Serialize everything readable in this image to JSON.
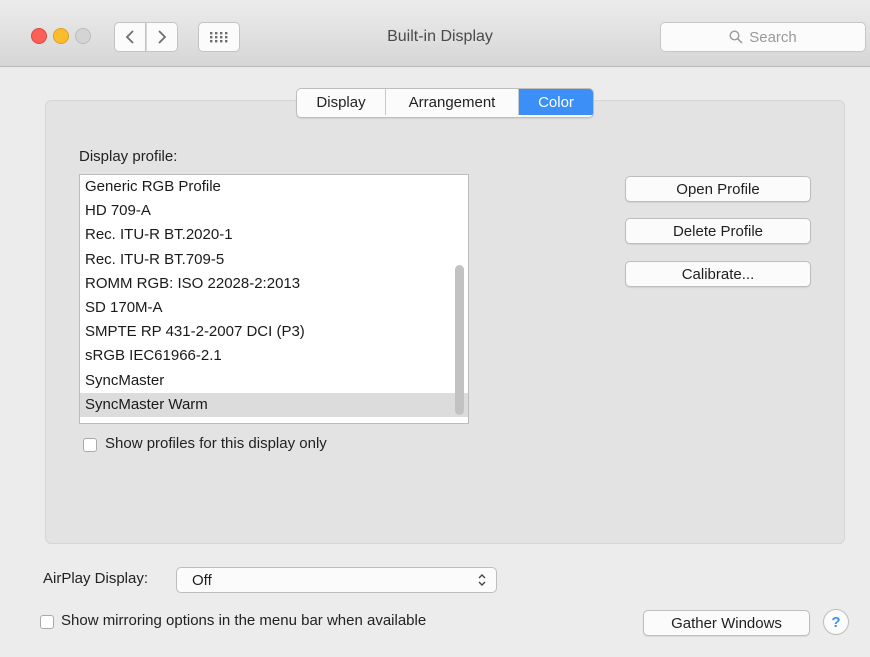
{
  "window": {
    "title": "Built-in Display",
    "search_placeholder": "Search",
    "traffic_lights": {
      "close": "#fc5f57",
      "minimize": "#fdbc2e",
      "zoom": "#d4d4d4"
    }
  },
  "tabs": [
    {
      "label": "Display",
      "selected": false
    },
    {
      "label": "Arrangement",
      "selected": false
    },
    {
      "label": "Color",
      "selected": true
    }
  ],
  "color_tab": {
    "profile_label": "Display profile:",
    "profiles": [
      "Generic RGB Profile",
      "HD 709-A",
      "Rec. ITU-R BT.2020-1",
      "Rec. ITU-R BT.709-5",
      "ROMM RGB: ISO 22028-2:2013",
      "SD 170M-A",
      "SMPTE RP 431-2-2007 DCI (P3)",
      "sRGB IEC61966-2.1",
      "SyncMaster",
      "SyncMaster Warm"
    ],
    "selected_profile": "SyncMaster Warm",
    "show_profiles_checkbox": "Show profiles for this display only",
    "buttons": {
      "open": "Open Profile",
      "delete": "Delete Profile",
      "calibrate": "Calibrate..."
    }
  },
  "footer": {
    "airplay_label": "AirPlay Display:",
    "airplay_value": "Off",
    "mirroring_checkbox": "Show mirroring options in the menu bar when available",
    "gather_windows": "Gather Windows",
    "help": "?"
  },
  "accent_color": "#3b8ff7"
}
